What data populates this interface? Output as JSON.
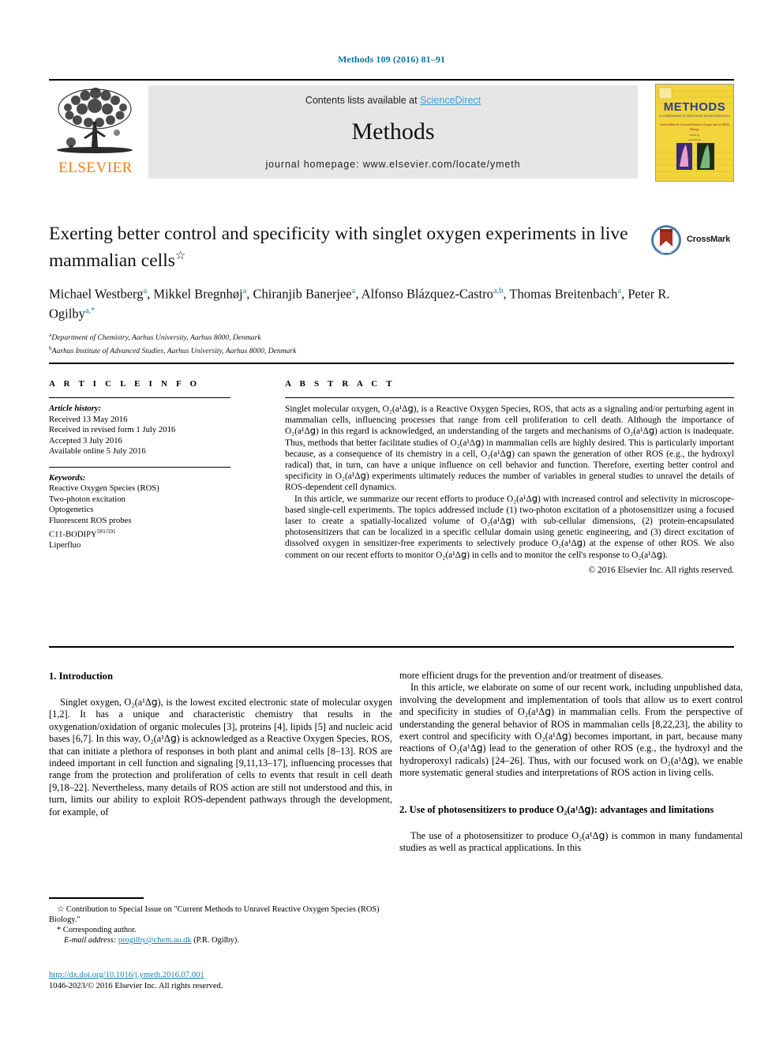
{
  "running_head": "Methods 109 (2016) 81–91",
  "masthead": {
    "contents_prefix": "Contents lists available at ",
    "sciencedirect": "ScienceDirect",
    "journal_title": "Methods",
    "homepage": "journal homepage: www.elsevier.com/locate/ymeth",
    "publisher": "ELSEVIER",
    "cover_title": "METHODS",
    "cover_subtitle": "A COMPANION TO METHODS IN ENZYMOLOGY",
    "cover_issue_line": "Current Methods to Unravel Reactive Oxygen Species (ROS) Biology",
    "colors": {
      "link": "#3ea1d8",
      "running_head": "#12739e",
      "elsevier_orange": "#f07f13",
      "banner_gray": "#e6e6e6",
      "cover_yellow": "#f2d43c"
    }
  },
  "article": {
    "title": "Exerting better control and specificity with singlet oxygen experiments in live mammalian cells",
    "title_footnote_marker": "☆",
    "crossmark_label": "CrossMark",
    "authors_line1_parts": [
      {
        "name": "Michael Westberg",
        "marks": "a"
      },
      {
        "name": "Mikkel Bregnhøj",
        "marks": "a"
      },
      {
        "name": "Chiranjib Banerjee",
        "marks": "a"
      },
      {
        "name": "Alfonso Blázquez-Castro",
        "marks": "a,b"
      }
    ],
    "authors_line2_parts": [
      {
        "name": "Thomas Breitenbach",
        "marks": "a"
      },
      {
        "name": "Peter R. Ogilby",
        "marks": "a,*"
      }
    ],
    "affiliations": [
      {
        "mark": "a",
        "text": "Department of Chemistry, Aarhus University, Aarhus 8000, Denmark"
      },
      {
        "mark": "b",
        "text": "Aarhus Institute of Advanced Studies, Aarhus University, Aarhus 8000, Denmark"
      }
    ]
  },
  "article_info": {
    "heading": "A R T I C L E    I N F O",
    "history_title": "Article history:",
    "history": [
      "Received 13 May 2016",
      "Received in revised form 1 July 2016",
      "Accepted 3 July 2016",
      "Available online 5 July 2016"
    ],
    "keywords_title": "Keywords:",
    "keywords": [
      "Reactive Oxygen Species (ROS)",
      "Two-photon excitation",
      "Optogenetics",
      "Fluorescent ROS probes",
      "C11-BODIPY",
      "Liperfluo"
    ],
    "bodipy_superscript": "581/591"
  },
  "abstract": {
    "heading": "A B S T R A C T",
    "paragraph1": "Singlet molecular oxygen, O₂(a¹Δ𝗀), is a Reactive Oxygen Species, ROS, that acts as a signaling and/or perturbing agent in mammalian cells, influencing processes that range from cell proliferation to cell death. Although the importance of O₂(a¹Δ𝗀) in this regard is acknowledged, an understanding of the targets and mechanisms of O₂(a¹Δ𝗀) action is inadequate. Thus, methods that better facilitate studies of O₂(a¹Δ𝗀) in mammalian cells are highly desired. This is particularly important because, as a consequence of its chemistry in a cell, O₂(a¹Δ𝗀) can spawn the generation of other ROS (e.g., the hydroxyl radical) that, in turn, can have a unique influence on cell behavior and function. Therefore, exerting better control and specificity in O₂(a¹Δ𝗀) experiments ultimately reduces the number of variables in general studies to unravel the details of ROS-dependent cell dynamics.",
    "paragraph2": "In this article, we summarize our recent efforts to produce O₂(a¹Δ𝗀) with increased control and selectivity in microscope-based single-cell experiments. The topics addressed include (1) two-photon excitation of a photosensitizer using a focused laser to create a spatially-localized volume of O₂(a¹Δ𝗀) with sub-cellular dimensions, (2) protein-encapsulated photosensitizers that can be localized in a specific cellular domain using genetic engineering, and (3) direct excitation of dissolved oxygen in sensitizer-free experiments to selectively produce O₂(a¹Δ𝗀) at the expense of other ROS. We also comment on our recent efforts to monitor O₂(a¹Δ𝗀) in cells and to monitor the cell's response to O₂(a¹Δ𝗀).",
    "copyright": "© 2016 Elsevier Inc. All rights reserved."
  },
  "body": {
    "section1_heading": "1. Introduction",
    "left_p1": "Singlet oxygen, O₂(a¹Δ𝗀), is the lowest excited electronic state of molecular oxygen [1,2]. It has a unique and characteristic chemistry that results in the oxygenation/oxidation of organic molecules [3], proteins [4], lipids [5] and nucleic acid bases [6,7]. In this way, O₂(a¹Δ𝗀) is acknowledged as a Reactive Oxygen Species, ROS, that can initiate a plethora of responses in both plant and animal cells [8–13]. ROS are indeed important in cell function and signaling [9,11,13–17], influencing processes that range from the protection and proliferation of cells to events that result in cell death [9,18–22]. Nevertheless, many details of ROS action are still not understood and this, in turn, limits our ability to exploit ROS-dependent pathways through the development, for example, of",
    "right_p1_cont": "more efficient drugs for the prevention and/or treatment of diseases.",
    "right_p2": "In this article, we elaborate on some of our recent work, including unpublished data, involving the development and implementation of tools that allow us to exert control and specificity in studies of O₂(a¹Δ𝗀) in mammalian cells. From the perspective of understanding the general behavior of ROS in mammalian cells [8,22,23], the ability to exert control and specificity with O₂(a¹Δ𝗀) becomes important, in part, because many reactions of O₂(a¹Δ𝗀) lead to the generation of other ROS (e.g., the hydroxyl and the hydroperoxyl radicals) [24–26]. Thus, with our focused work on O₂(a¹Δ𝗀), we enable more systematic general studies and interpretations of ROS action in living cells.",
    "section2_heading": "2. Use of photosensitizers to produce O₂(a¹Δ𝗀): advantages and limitations",
    "right_p3": "The use of a photosensitizer to produce O₂(a¹Δ𝗀) is common in many fundamental studies as well as practical applications. In this"
  },
  "footnotes": {
    "star_note": "☆ Contribution to Special Issue on \"Current Methods to Unravel Reactive Oxygen Species (ROS) Biology.\"",
    "corresponding": "* Corresponding author.",
    "email_label": "E-mail address:",
    "email": "progilby@chem.au.dk",
    "email_suffix": "(P.R. Ogilby).",
    "doi": "http://dx.doi.org/10.1016/j.ymeth.2016.07.001",
    "issn_line": "1046-2023/© 2016 Elsevier Inc. All rights reserved."
  }
}
